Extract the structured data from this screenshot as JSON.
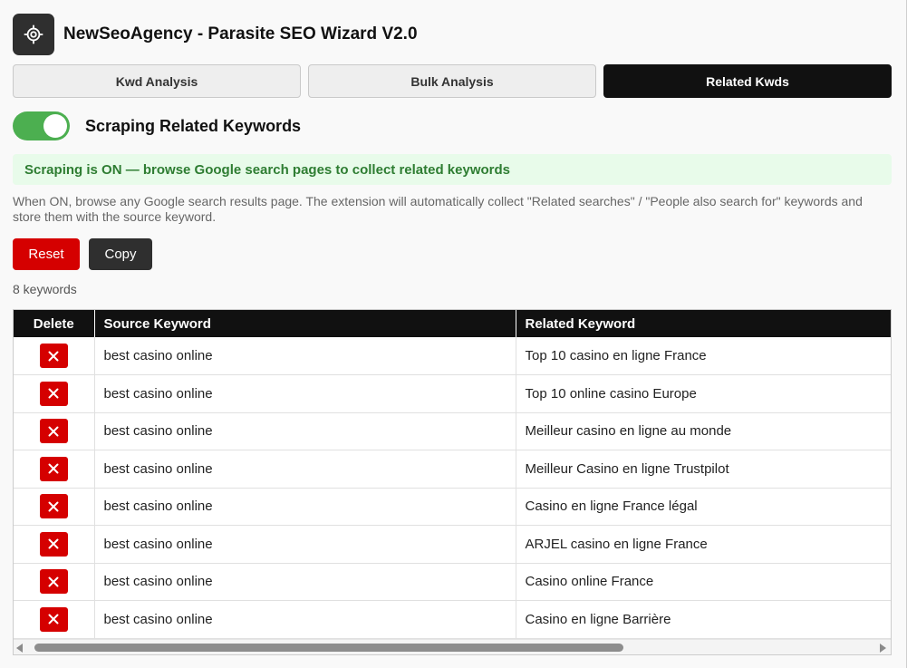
{
  "app": {
    "title": "NewSeoAgency - Parasite SEO Wizard V2.0",
    "logo_icon": "gear-icon"
  },
  "tabs": [
    {
      "label": "Kwd Analysis",
      "active": false
    },
    {
      "label": "Bulk Analysis",
      "active": false
    },
    {
      "label": "Related Kwds",
      "active": true
    }
  ],
  "scraping": {
    "toggle_on": true,
    "label": "Scraping Related Keywords",
    "status": "Scraping is ON — browse Google search pages to collect related keywords",
    "help": "When ON, browse any Google search results page. The extension will automatically collect \"Related searches\" / \"People also search for\" keywords and store them with the source keyword."
  },
  "actions": {
    "reset_label": "Reset",
    "copy_label": "Copy"
  },
  "count_text": "8 keywords",
  "table": {
    "headers": {
      "delete": "Delete",
      "source": "Source Keyword",
      "related": "Related Keyword"
    },
    "rows": [
      {
        "source": "best casino online",
        "related": "Top 10 casino en ligne France"
      },
      {
        "source": "best casino online",
        "related": "Top 10 online casino Europe"
      },
      {
        "source": "best casino online",
        "related": "Meilleur casino en ligne au monde"
      },
      {
        "source": "best casino online",
        "related": "Meilleur Casino en ligne Trustpilot"
      },
      {
        "source": "best casino online",
        "related": "Casino en ligne France légal"
      },
      {
        "source": "best casino online",
        "related": "ARJEL casino en ligne France"
      },
      {
        "source": "best casino online",
        "related": "Casino online France"
      },
      {
        "source": "best casino online",
        "related": "Casino en ligne Barrière"
      }
    ]
  },
  "colors": {
    "accent_dark": "#111111",
    "toggle_green": "#4caf50",
    "status_bg": "#e8fbea",
    "status_text": "#2e7d32",
    "danger": "#d50000"
  }
}
